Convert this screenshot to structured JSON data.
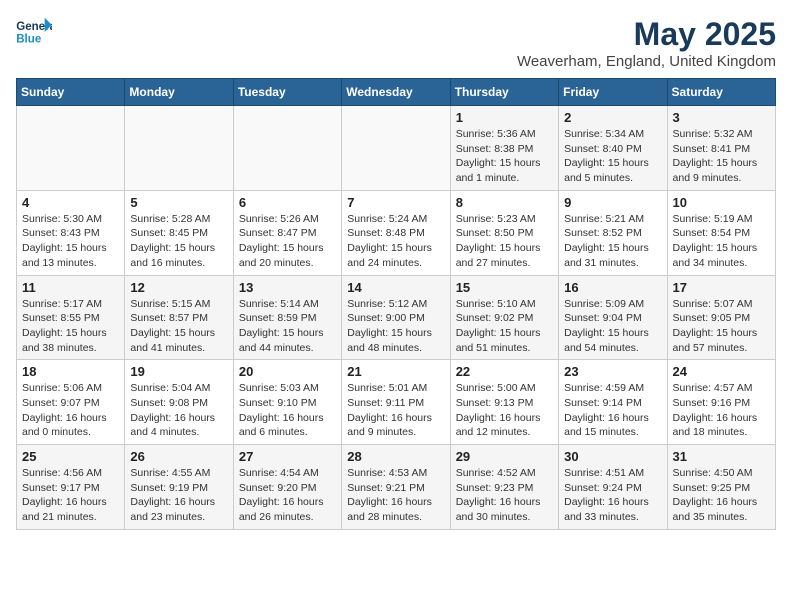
{
  "header": {
    "logo_line1": "General",
    "logo_line2": "Blue",
    "month": "May 2025",
    "location": "Weaverham, England, United Kingdom"
  },
  "weekdays": [
    "Sunday",
    "Monday",
    "Tuesday",
    "Wednesday",
    "Thursday",
    "Friday",
    "Saturday"
  ],
  "weeks": [
    [
      {
        "day": "",
        "info": ""
      },
      {
        "day": "",
        "info": ""
      },
      {
        "day": "",
        "info": ""
      },
      {
        "day": "",
        "info": ""
      },
      {
        "day": "1",
        "info": "Sunrise: 5:36 AM\nSunset: 8:38 PM\nDaylight: 15 hours\nand 1 minute."
      },
      {
        "day": "2",
        "info": "Sunrise: 5:34 AM\nSunset: 8:40 PM\nDaylight: 15 hours\nand 5 minutes."
      },
      {
        "day": "3",
        "info": "Sunrise: 5:32 AM\nSunset: 8:41 PM\nDaylight: 15 hours\nand 9 minutes."
      }
    ],
    [
      {
        "day": "4",
        "info": "Sunrise: 5:30 AM\nSunset: 8:43 PM\nDaylight: 15 hours\nand 13 minutes."
      },
      {
        "day": "5",
        "info": "Sunrise: 5:28 AM\nSunset: 8:45 PM\nDaylight: 15 hours\nand 16 minutes."
      },
      {
        "day": "6",
        "info": "Sunrise: 5:26 AM\nSunset: 8:47 PM\nDaylight: 15 hours\nand 20 minutes."
      },
      {
        "day": "7",
        "info": "Sunrise: 5:24 AM\nSunset: 8:48 PM\nDaylight: 15 hours\nand 24 minutes."
      },
      {
        "day": "8",
        "info": "Sunrise: 5:23 AM\nSunset: 8:50 PM\nDaylight: 15 hours\nand 27 minutes."
      },
      {
        "day": "9",
        "info": "Sunrise: 5:21 AM\nSunset: 8:52 PM\nDaylight: 15 hours\nand 31 minutes."
      },
      {
        "day": "10",
        "info": "Sunrise: 5:19 AM\nSunset: 8:54 PM\nDaylight: 15 hours\nand 34 minutes."
      }
    ],
    [
      {
        "day": "11",
        "info": "Sunrise: 5:17 AM\nSunset: 8:55 PM\nDaylight: 15 hours\nand 38 minutes."
      },
      {
        "day": "12",
        "info": "Sunrise: 5:15 AM\nSunset: 8:57 PM\nDaylight: 15 hours\nand 41 minutes."
      },
      {
        "day": "13",
        "info": "Sunrise: 5:14 AM\nSunset: 8:59 PM\nDaylight: 15 hours\nand 44 minutes."
      },
      {
        "day": "14",
        "info": "Sunrise: 5:12 AM\nSunset: 9:00 PM\nDaylight: 15 hours\nand 48 minutes."
      },
      {
        "day": "15",
        "info": "Sunrise: 5:10 AM\nSunset: 9:02 PM\nDaylight: 15 hours\nand 51 minutes."
      },
      {
        "day": "16",
        "info": "Sunrise: 5:09 AM\nSunset: 9:04 PM\nDaylight: 15 hours\nand 54 minutes."
      },
      {
        "day": "17",
        "info": "Sunrise: 5:07 AM\nSunset: 9:05 PM\nDaylight: 15 hours\nand 57 minutes."
      }
    ],
    [
      {
        "day": "18",
        "info": "Sunrise: 5:06 AM\nSunset: 9:07 PM\nDaylight: 16 hours\nand 0 minutes."
      },
      {
        "day": "19",
        "info": "Sunrise: 5:04 AM\nSunset: 9:08 PM\nDaylight: 16 hours\nand 4 minutes."
      },
      {
        "day": "20",
        "info": "Sunrise: 5:03 AM\nSunset: 9:10 PM\nDaylight: 16 hours\nand 6 minutes."
      },
      {
        "day": "21",
        "info": "Sunrise: 5:01 AM\nSunset: 9:11 PM\nDaylight: 16 hours\nand 9 minutes."
      },
      {
        "day": "22",
        "info": "Sunrise: 5:00 AM\nSunset: 9:13 PM\nDaylight: 16 hours\nand 12 minutes."
      },
      {
        "day": "23",
        "info": "Sunrise: 4:59 AM\nSunset: 9:14 PM\nDaylight: 16 hours\nand 15 minutes."
      },
      {
        "day": "24",
        "info": "Sunrise: 4:57 AM\nSunset: 9:16 PM\nDaylight: 16 hours\nand 18 minutes."
      }
    ],
    [
      {
        "day": "25",
        "info": "Sunrise: 4:56 AM\nSunset: 9:17 PM\nDaylight: 16 hours\nand 21 minutes."
      },
      {
        "day": "26",
        "info": "Sunrise: 4:55 AM\nSunset: 9:19 PM\nDaylight: 16 hours\nand 23 minutes."
      },
      {
        "day": "27",
        "info": "Sunrise: 4:54 AM\nSunset: 9:20 PM\nDaylight: 16 hours\nand 26 minutes."
      },
      {
        "day": "28",
        "info": "Sunrise: 4:53 AM\nSunset: 9:21 PM\nDaylight: 16 hours\nand 28 minutes."
      },
      {
        "day": "29",
        "info": "Sunrise: 4:52 AM\nSunset: 9:23 PM\nDaylight: 16 hours\nand 30 minutes."
      },
      {
        "day": "30",
        "info": "Sunrise: 4:51 AM\nSunset: 9:24 PM\nDaylight: 16 hours\nand 33 minutes."
      },
      {
        "day": "31",
        "info": "Sunrise: 4:50 AM\nSunset: 9:25 PM\nDaylight: 16 hours\nand 35 minutes."
      }
    ]
  ]
}
